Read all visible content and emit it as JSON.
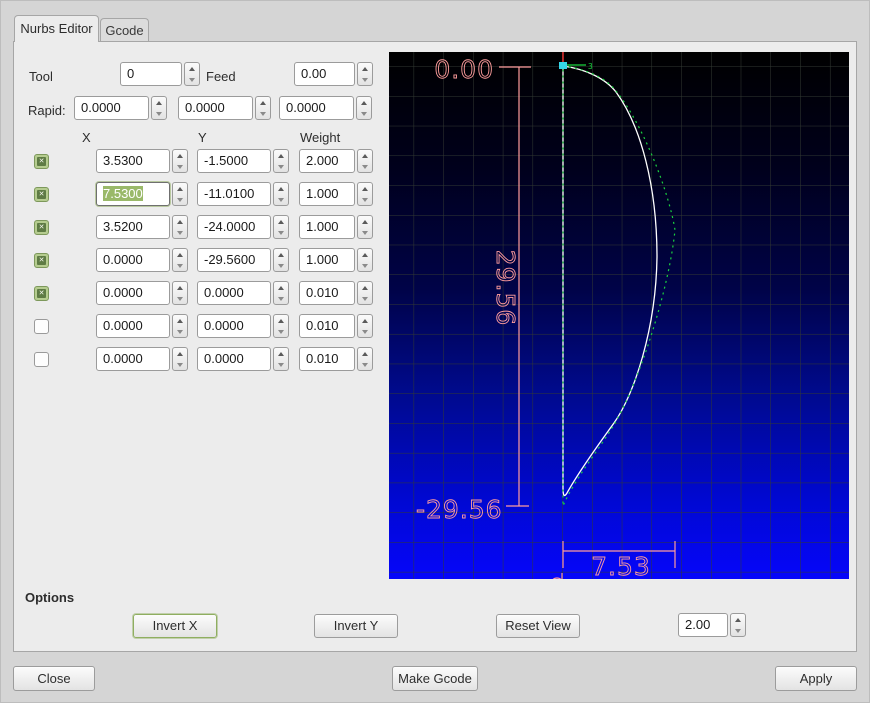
{
  "tabs": [
    {
      "label": "Nurbs Editor",
      "active": true
    },
    {
      "label": "Gcode",
      "active": false
    }
  ],
  "header": {
    "tool_label": "Tool",
    "tool_value": "0",
    "feed_label": "Feed",
    "feed_value": "0.00",
    "rapid_label": "Rapid:",
    "rapid": [
      "0.0000",
      "0.0000",
      "0.0000"
    ]
  },
  "table": {
    "columns": [
      "X",
      "Y",
      "Weight"
    ],
    "rows": [
      {
        "checked": true,
        "x": "3.5300",
        "x_selected": false,
        "y": "-1.5000",
        "weight": "2.000"
      },
      {
        "checked": true,
        "x": "7.5300",
        "x_selected": true,
        "y": "-11.0100",
        "weight": "1.000"
      },
      {
        "checked": true,
        "x": "3.5200",
        "x_selected": false,
        "y": "-24.0000",
        "weight": "1.000"
      },
      {
        "checked": true,
        "x": "0.0000",
        "x_selected": false,
        "y": "-29.5600",
        "weight": "1.000"
      },
      {
        "checked": true,
        "x": "0.0000",
        "x_selected": false,
        "y": "0.0000",
        "weight": "0.010"
      },
      {
        "checked": false,
        "x": "0.0000",
        "x_selected": false,
        "y": "0.0000",
        "weight": "0.010"
      },
      {
        "checked": false,
        "x": "0.0000",
        "x_selected": false,
        "y": "0.0000",
        "weight": "0.010"
      }
    ]
  },
  "preview": {
    "dimensions": {
      "top": "0.00",
      "height": "29.56",
      "bottom": "-29.56",
      "width": "7.53"
    },
    "marker_label": "3",
    "control_points": [
      [
        3.53,
        -1.5
      ],
      [
        7.53,
        -11.01
      ],
      [
        3.52,
        -24.0
      ],
      [
        0.0,
        -29.56
      ],
      [
        0.0,
        0.0
      ]
    ],
    "colors": {
      "curve": "#ffffff",
      "control_polygon": "#19d23f",
      "dimension": "#ff9d9d",
      "start_point": "#35d6e8",
      "start_tick": "#e83030",
      "grid": "#333a33",
      "bg_top": "#000000",
      "bg_bottom": "#0606fa"
    }
  },
  "options": {
    "title": "Options",
    "invert_x": "Invert X",
    "invert_y": "Invert Y",
    "reset_view": "Reset View",
    "scale_value": "2.00"
  },
  "footer": {
    "close": "Close",
    "make_gcode": "Make Gcode",
    "apply": "Apply"
  }
}
